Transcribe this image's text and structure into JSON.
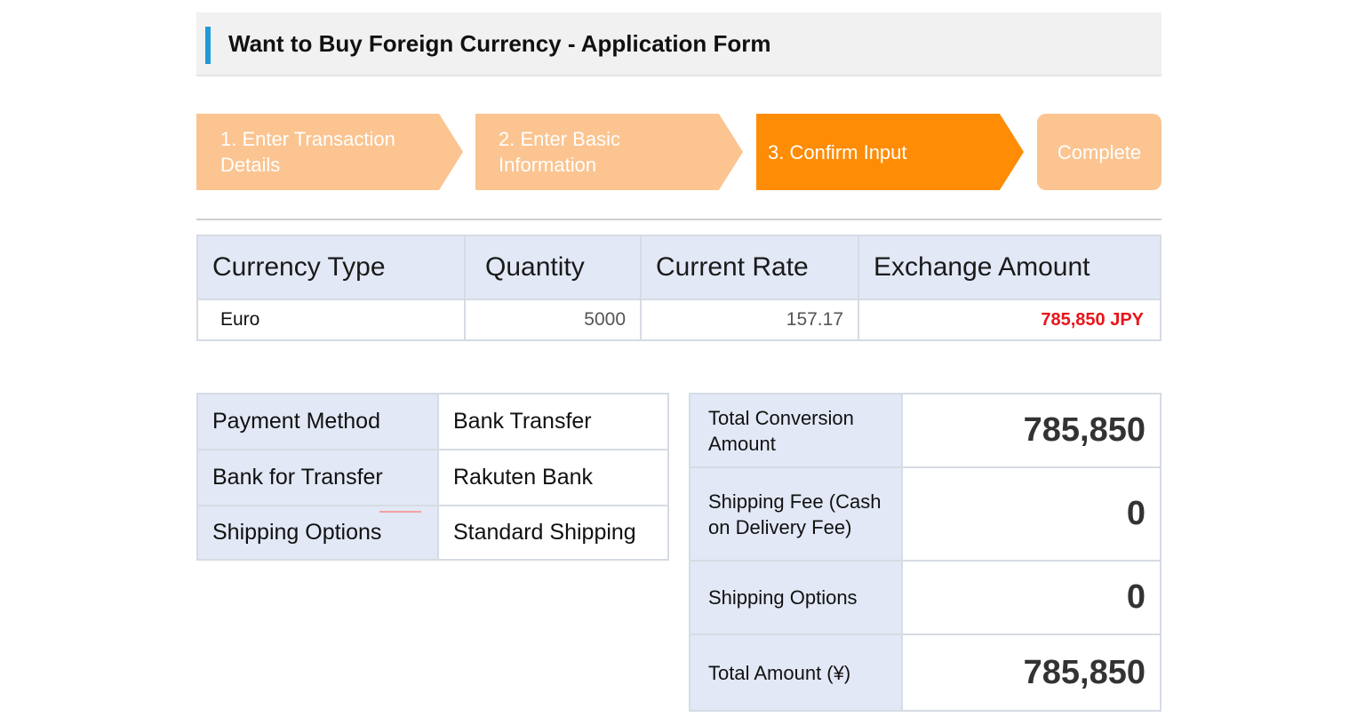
{
  "header": {
    "title": "Want to Buy Foreign Currency - Application Form"
  },
  "steps": [
    {
      "label": "1. Enter Transaction Details",
      "state": "done"
    },
    {
      "label": "2. Enter Basic Information",
      "state": "done"
    },
    {
      "label": "3. Confirm Input",
      "state": "active"
    },
    {
      "label": "Complete",
      "state": "pending"
    }
  ],
  "rate_table": {
    "headers": [
      "Currency Type",
      "Quantity",
      "Current Rate",
      "Exchange Amount"
    ],
    "row": {
      "currency": "Euro",
      "quantity": "5000",
      "rate": "157.17",
      "amount": "785,850 JPY"
    }
  },
  "details": [
    {
      "label": "Payment Method",
      "value": "Bank Transfer"
    },
    {
      "label": "Bank for Transfer",
      "value": "Rakuten Bank"
    },
    {
      "label": "Shipping Options",
      "value": "Standard Shipping"
    }
  ],
  "summary": [
    {
      "label": "Total Conversion Amount",
      "value": "785,850"
    },
    {
      "label": "Shipping Fee (Cash on Delivery Fee)",
      "value": "0"
    },
    {
      "label": "Shipping Options",
      "value": "0"
    },
    {
      "label": "Total Amount (¥)",
      "value": "785,850"
    }
  ],
  "colors": {
    "accent": "#1f9ad6",
    "step_done": "#fbc490",
    "step_active": "#ff8c05",
    "header_cell": "#e2e8f5",
    "amount_red": "#e8141a"
  }
}
